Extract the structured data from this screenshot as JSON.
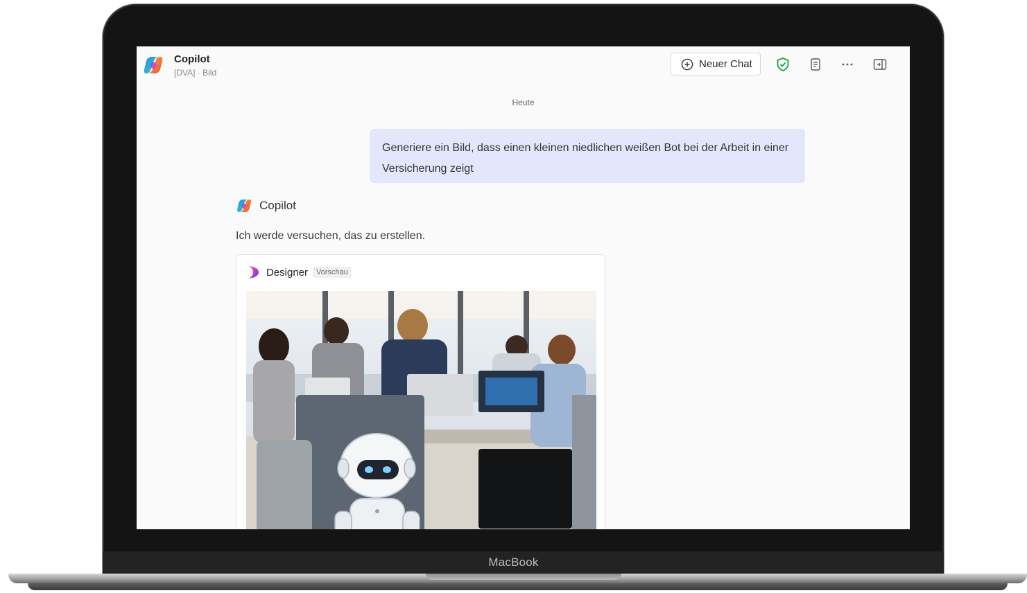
{
  "app": {
    "title": "Copilot",
    "subtitle": "[DVA] · Bild"
  },
  "toolbar": {
    "new_chat_label": "Neuer Chat",
    "icons": [
      "plus-circle-icon",
      "shield-check-icon",
      "document-icon",
      "more-icon",
      "panel-icon"
    ]
  },
  "chat": {
    "date_separator": "Heute",
    "user_message": "Generiere ein Bild, dass einen kleinen niedlichen weißen Bot bei der Arbeit in einer Versicherung zeigt",
    "bot_name": "Copilot",
    "bot_reply": "Ich werde versuchen, das zu erstellen.",
    "card": {
      "title": "Designer",
      "badge": "Vorschau"
    }
  },
  "device": {
    "label": "MacBook"
  },
  "colors": {
    "user_bubble": "#e3e7fb",
    "shield_green": "#15a04a",
    "screen_bg": "#fafafa"
  }
}
